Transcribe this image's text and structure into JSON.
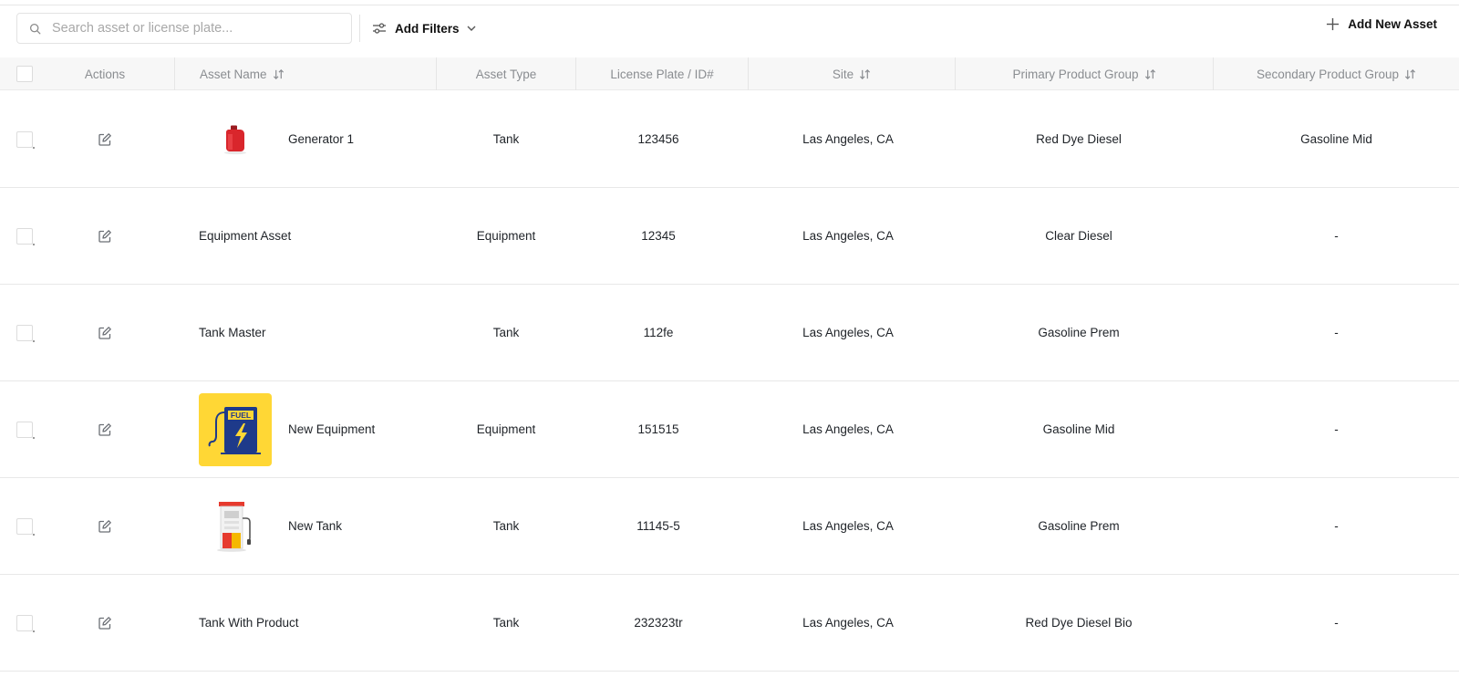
{
  "toolbar": {
    "search_placeholder": "Search asset or license plate...",
    "filters_label": "Add Filters",
    "add_label": "Add New Asset"
  },
  "columns": {
    "actions": "Actions",
    "asset_name": "Asset Name",
    "asset_type": "Asset Type",
    "license": "License Plate / ID#",
    "site": "Site",
    "primary": "Primary Product Group",
    "secondary": "Secondary Product Group"
  },
  "icons": {
    "search": "search-icon",
    "filters": "sliders-icon",
    "chevron": "chevron-down-icon",
    "plus": "plus-icon",
    "sort": "sort-icon",
    "edit": "edit-icon",
    "thumb_gas_can": "red-gas-can-icon",
    "thumb_fuel": "fuel-pump-bolt-icon",
    "thumb_pump": "gas-pump-icon"
  },
  "rows": [
    {
      "name": "Generator 1",
      "type": "Tank",
      "license": "123456",
      "site": "Las Angeles, CA",
      "primary": "Red Dye Diesel",
      "secondary": "Gasoline Mid"
    },
    {
      "name": "Equipment Asset",
      "type": "Equipment",
      "license": "12345",
      "site": "Las Angeles, CA",
      "primary": "Clear Diesel",
      "secondary": "-"
    },
    {
      "name": "Tank Master",
      "type": "Tank",
      "license": "112fe",
      "site": "Las Angeles, CA",
      "primary": "Gasoline Prem",
      "secondary": "-"
    },
    {
      "name": "New Equipment",
      "type": "Equipment",
      "license": "151515",
      "site": "Las Angeles, CA",
      "primary": "Gasoline Mid",
      "secondary": "-"
    },
    {
      "name": "New Tank",
      "type": "Tank",
      "license": "11145-5",
      "site": "Las Angeles, CA",
      "primary": "Gasoline Prem",
      "secondary": "-"
    },
    {
      "name": "Tank With Product",
      "type": "Tank",
      "license": "232323tr",
      "site": "Las Angeles, CA",
      "primary": "Red Dye Diesel Bio",
      "secondary": "-"
    }
  ],
  "thumb_text": {
    "fuel": "FUEL"
  },
  "colors": {
    "header_bg": "#f7f7f7",
    "thumb_yellow": "#ffd735",
    "text": "#1f2328",
    "muted": "#8a8d91"
  }
}
